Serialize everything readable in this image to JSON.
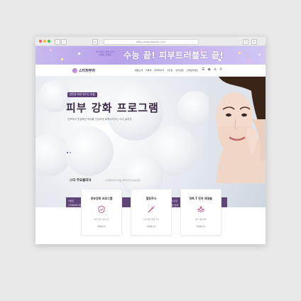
{
  "browser": {
    "url": "https://www.stiplastic.co.kr/"
  },
  "banner": {
    "small_text": "올 하반기 피부 관리 이벤트 진행중",
    "title": "수능 끝! 피부트러블도 끝!",
    "close_icon": "close-icon"
  },
  "nav": {
    "logo": "스티피부과",
    "menu": [
      "병원소개",
      "피부과",
      "피부레이저",
      "리프팅",
      "쁘띠성형",
      "스페셜이벤트"
    ],
    "icons": [
      "menu-icon",
      "user-icon",
      "lock-icon",
      "search-icon"
    ]
  },
  "hero": {
    "badge": "탄탄한 피부 만드는 비결",
    "title": "피부 강화 프로그램",
    "subtitle": "건조하고 민감해진 피부를 건강하게 회복시켜주는 스티 솔루션",
    "slides": 2,
    "active_slide": 0
  },
  "cards": [
    {
      "title": "이벤트",
      "sub": "스티피부과 대표 피부관리 프로그램 안내"
    },
    {
      "title": "공지사항",
      "sub": "휴진 안내"
    }
  ],
  "section": {
    "title": "스티 주요클리닉",
    "subtitle": "스티피부과의 대표 클리닉을 만나보세요"
  },
  "services": [
    {
      "title": "피부강화 프로그램",
      "desc": "피부 장벽 강화 관리",
      "more": "자세히보기",
      "icon": "shield-icon"
    },
    {
      "title": "힐링주사",
      "desc": "피부 재생 영양 주사",
      "more": "자세히보기",
      "icon": "syringe-icon"
    },
    {
      "title": "DR.T 전처 재생술",
      "desc": "피부 재생 케어",
      "more": "자세히보기",
      "icon": "layers-icon"
    }
  ],
  "colors": {
    "accent": "#5a3f7a",
    "banner": "#b6a2ea",
    "card": "#5f4477"
  }
}
